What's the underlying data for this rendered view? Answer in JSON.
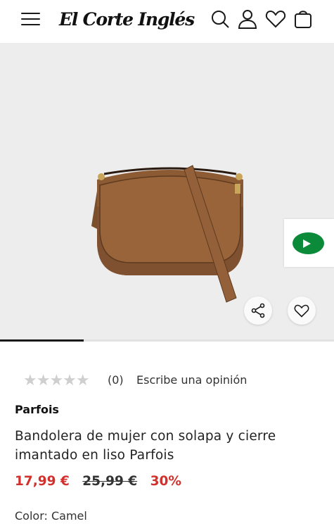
{
  "header": {
    "logo_text": "El Corte Inglés",
    "icons": [
      "menu-icon",
      "search-icon",
      "user-icon",
      "heart-icon",
      "bag-icon"
    ]
  },
  "gallery": {
    "progress": 0.25,
    "colors": {
      "background": "#ededed",
      "bag": "#8a5a34",
      "tab_accent": "#0b8a3a"
    }
  },
  "product": {
    "rating_count": "(0)",
    "review_link": "Escribe una opinión",
    "brand": "Parfois",
    "title": "Bandolera de mujer con solapa y cierre imantado en liso Parfois",
    "price_current": "17,99 €",
    "price_old": "25,99 €",
    "discount": "30%",
    "color_label": "Color: Camel"
  },
  "colors": {
    "sale_red": "#d0312d",
    "text": "#222222"
  }
}
